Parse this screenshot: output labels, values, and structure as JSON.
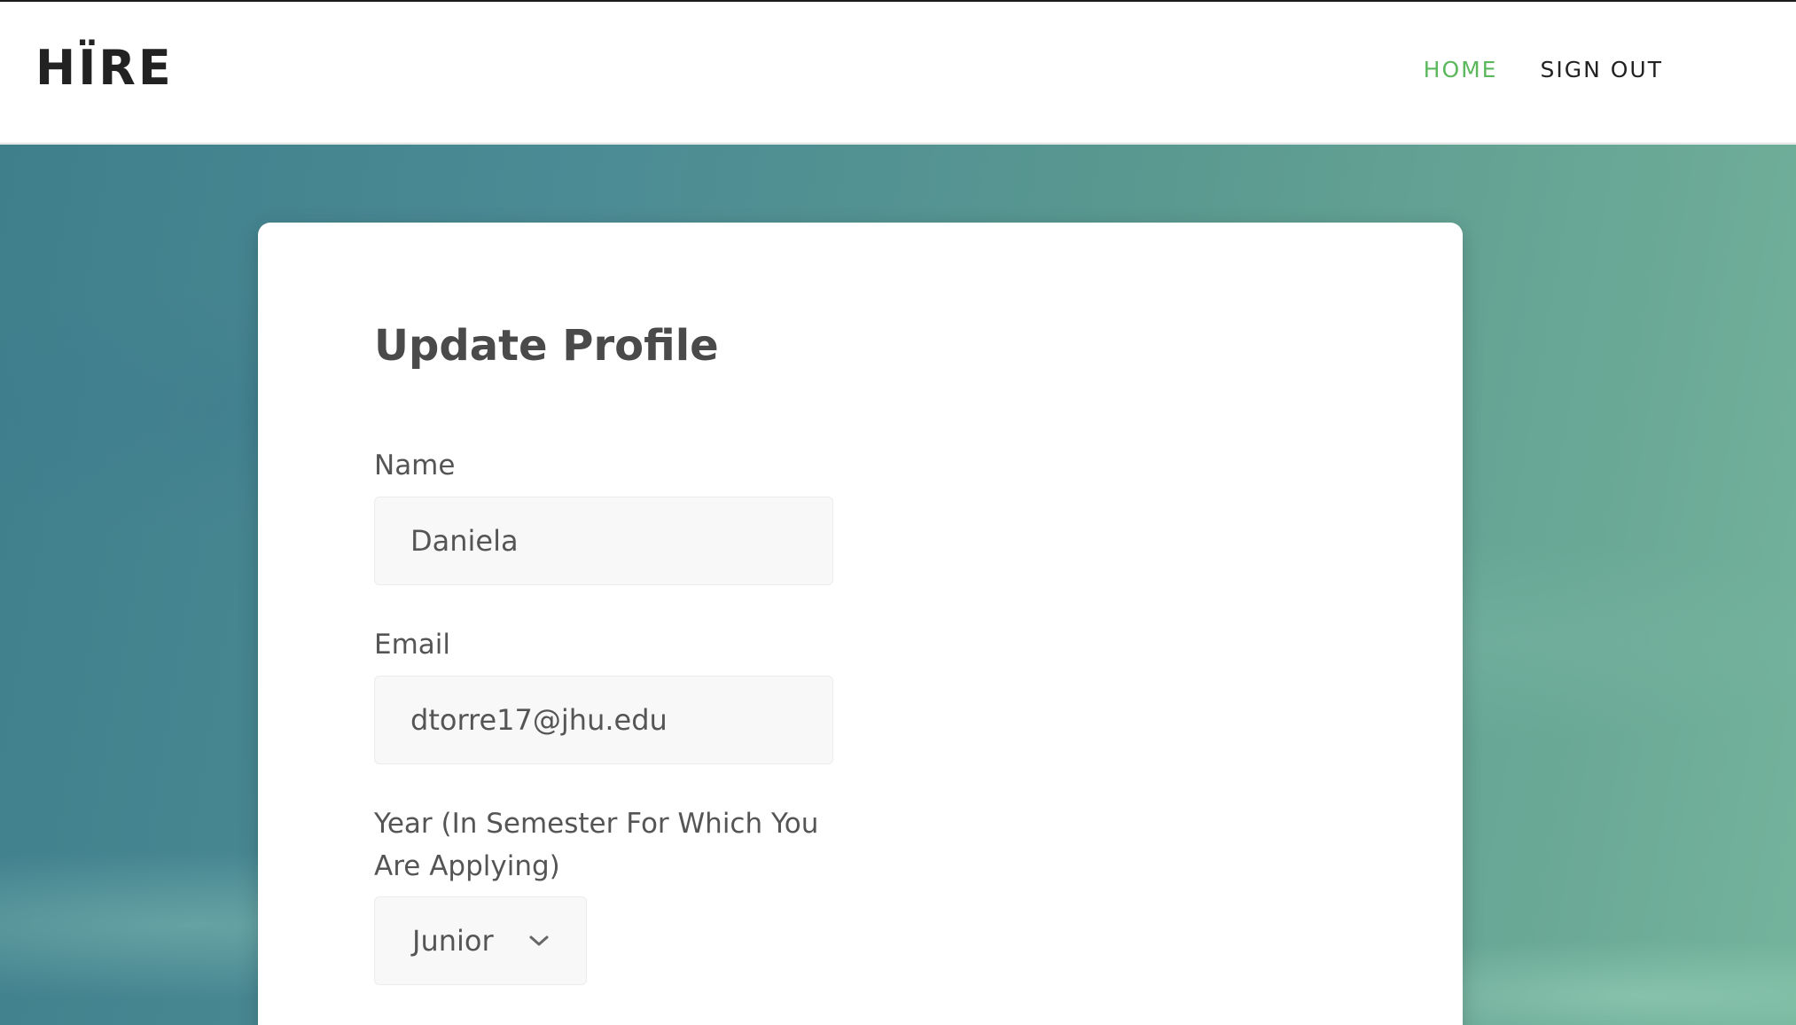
{
  "brand": {
    "logo_text": "HÏRE"
  },
  "nav": {
    "items": [
      {
        "label": "HOME",
        "active": true
      },
      {
        "label": "SIGN OUT",
        "active": false
      }
    ],
    "active_color": "#5cb85c"
  },
  "form": {
    "title": "Update Profile",
    "fields": {
      "name": {
        "label": "Name",
        "value": "Daniela"
      },
      "email": {
        "label": "Email",
        "value": "dtorre17@jhu.edu"
      },
      "year": {
        "label": "Year (In Semester For Which You Are Applying)",
        "value": "Junior"
      }
    }
  },
  "icons": {
    "year_dropdown": "chevron-down-icon"
  }
}
